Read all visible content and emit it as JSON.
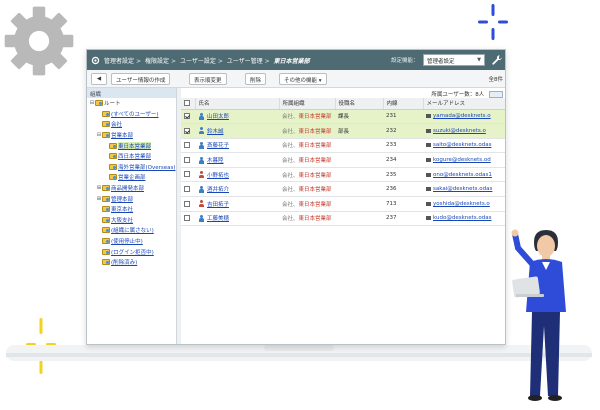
{
  "colors": {
    "titlebar": "#4e6b74",
    "selected_row": "#e6f3c8",
    "link": "#1a47b8",
    "dept_red": "#c23a2b",
    "gear": "#b9b9b9",
    "spark_blue": "#2f4cd8",
    "spark_yellow": "#f3d21b"
  },
  "breadcrumb": [
    "管理者設定",
    "権限設定",
    "ユーザー設定",
    "ユーザー管理",
    "東日本営業部"
  ],
  "settings": {
    "label": "設定機能：",
    "value": "管理者設定"
  },
  "toolbar": {
    "back_icon": "arrow-left-icon",
    "create": "ユーザー情報の作成",
    "change": "表示順変更",
    "delete": "削除",
    "other": "その他の機能 ▾",
    "count": "全8件"
  },
  "sidebar": {
    "title": "組織",
    "items": [
      {
        "label": "ルート",
        "toggle": "⊟",
        "link": false
      },
      {
        "label": "(すべてのユーザー)",
        "toggle": "",
        "link": true
      },
      {
        "label": "会社",
        "toggle": "",
        "link": true
      },
      {
        "label": "営業本部",
        "toggle": "⊟",
        "link": true
      },
      {
        "label": "東日本営業部",
        "toggle": "",
        "link": true,
        "selected": true
      },
      {
        "label": "西日本営業部",
        "toggle": "",
        "link": true
      },
      {
        "label": "海外営業部(Overseas)",
        "toggle": "",
        "link": true
      },
      {
        "label": "営業企画部",
        "toggle": "",
        "link": true
      },
      {
        "label": "商品開発本部",
        "toggle": "⊞",
        "link": true
      },
      {
        "label": "管理本部",
        "toggle": "⊞",
        "link": true
      },
      {
        "label": "東京本社",
        "toggle": "",
        "link": true
      },
      {
        "label": "大阪支社",
        "toggle": "",
        "link": true
      },
      {
        "label": "(組織に属さない)",
        "toggle": "",
        "link": true
      },
      {
        "label": "(使用停止中)",
        "toggle": "",
        "link": true
      },
      {
        "label": "(ログイン拒否中)",
        "toggle": "",
        "link": true
      },
      {
        "label": "(削除済み)",
        "toggle": "",
        "link": true
      }
    ]
  },
  "main": {
    "users_label": "所属ユーザー数：8人",
    "columns": [
      "氏名",
      "所属組織",
      "役職名",
      "内線",
      "メールアドレス"
    ],
    "rows": [
      {
        "checked": true,
        "name": "山田太郎",
        "org_prefix": "会社、",
        "org_dept": "東日本営業部",
        "title": "課長",
        "ext": "231",
        "email": "yamada@desknets.o",
        "avatar": "#3d7fc4"
      },
      {
        "checked": true,
        "name": "鈴木誠",
        "org_prefix": "会社、",
        "org_dept": "東日本営業部",
        "title": "部長",
        "ext": "232",
        "email": "suzuki@desknets.o",
        "avatar": "#3d7fc4"
      },
      {
        "checked": false,
        "name": "斎藤花子",
        "org_prefix": "会社、",
        "org_dept": "東日本営業部",
        "title": "",
        "ext": "233",
        "email": "saito@desknets.odas",
        "avatar": "#3d7fc4"
      },
      {
        "checked": false,
        "name": "木暮陸",
        "org_prefix": "会社、",
        "org_dept": "東日本営業部",
        "title": "",
        "ext": "234",
        "email": "kogure@desknets.od",
        "avatar": "#3d7fc4"
      },
      {
        "checked": false,
        "name": "小野拓也",
        "org_prefix": "会社、",
        "org_dept": "東日本営業部",
        "title": "",
        "ext": "235",
        "email": "ono@desknets.odas1",
        "avatar": "#c44a3d"
      },
      {
        "checked": false,
        "name": "酒井拓介",
        "org_prefix": "会社、",
        "org_dept": "東日本営業部",
        "title": "",
        "ext": "236",
        "email": "sakai@desknets.odas",
        "avatar": "#3d7fc4"
      },
      {
        "checked": false,
        "name": "吉田拓子",
        "org_prefix": "会社、",
        "org_dept": "東日本営業部",
        "title": "",
        "ext": "713",
        "email": "yoshida@desknets.o",
        "avatar": "#c44a3d"
      },
      {
        "checked": false,
        "name": "工藤美穂",
        "org_prefix": "会社、",
        "org_dept": "東日本営業部",
        "title": "",
        "ext": "237",
        "email": "kudo@desknets.odas",
        "avatar": "#3d7fc4"
      }
    ]
  }
}
